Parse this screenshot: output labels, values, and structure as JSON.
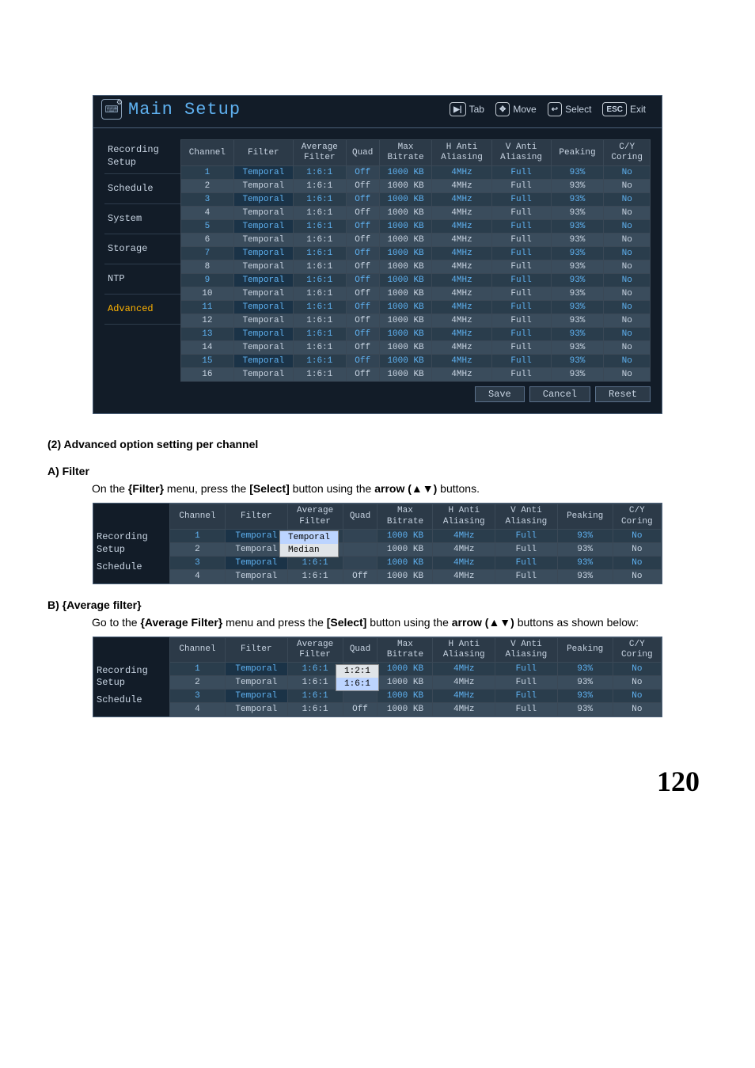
{
  "mainbox": {
    "title": "Main Setup",
    "nav": {
      "tab_icon": "▶|",
      "tab_label": "Tab",
      "move_icon": "✥",
      "move_label": "Move",
      "select_icon": "↩",
      "select_label": "Select",
      "exit_icon": "ESC",
      "exit_label": "Exit"
    },
    "sidebar": [
      {
        "label": "Recording Setup",
        "selected": false
      },
      {
        "label": "Schedule",
        "selected": false
      },
      {
        "label": "System",
        "selected": false
      },
      {
        "label": "Storage",
        "selected": false
      },
      {
        "label": "NTP",
        "selected": false
      },
      {
        "label": "Advanced",
        "selected": true
      }
    ],
    "columns": [
      "Channel",
      "Filter",
      "Average\nFilter",
      "Quad",
      "Max\nBitrate",
      "H Anti\nAliasing",
      "V Anti\nAliasing",
      "Peaking",
      "C/Y\nCoring"
    ],
    "rows": [
      {
        "ch": "1",
        "filter": "Temporal",
        "avg": "1:6:1",
        "quad": "Off",
        "bitrate": "1000 KB",
        "h": "4MHz",
        "v": "Full",
        "peak": "93%",
        "cy": "No",
        "hl": true
      },
      {
        "ch": "2",
        "filter": "Temporal",
        "avg": "1:6:1",
        "quad": "Off",
        "bitrate": "1000 KB",
        "h": "4MHz",
        "v": "Full",
        "peak": "93%",
        "cy": "No",
        "hl": false
      },
      {
        "ch": "3",
        "filter": "Temporal",
        "avg": "1:6:1",
        "quad": "Off",
        "bitrate": "1000 KB",
        "h": "4MHz",
        "v": "Full",
        "peak": "93%",
        "cy": "No",
        "hl": true
      },
      {
        "ch": "4",
        "filter": "Temporal",
        "avg": "1:6:1",
        "quad": "Off",
        "bitrate": "1000 KB",
        "h": "4MHz",
        "v": "Full",
        "peak": "93%",
        "cy": "No",
        "hl": false
      },
      {
        "ch": "5",
        "filter": "Temporal",
        "avg": "1:6:1",
        "quad": "Off",
        "bitrate": "1000 KB",
        "h": "4MHz",
        "v": "Full",
        "peak": "93%",
        "cy": "No",
        "hl": true
      },
      {
        "ch": "6",
        "filter": "Temporal",
        "avg": "1:6:1",
        "quad": "Off",
        "bitrate": "1000 KB",
        "h": "4MHz",
        "v": "Full",
        "peak": "93%",
        "cy": "No",
        "hl": false
      },
      {
        "ch": "7",
        "filter": "Temporal",
        "avg": "1:6:1",
        "quad": "Off",
        "bitrate": "1000 KB",
        "h": "4MHz",
        "v": "Full",
        "peak": "93%",
        "cy": "No",
        "hl": true
      },
      {
        "ch": "8",
        "filter": "Temporal",
        "avg": "1:6:1",
        "quad": "Off",
        "bitrate": "1000 KB",
        "h": "4MHz",
        "v": "Full",
        "peak": "93%",
        "cy": "No",
        "hl": false
      },
      {
        "ch": "9",
        "filter": "Temporal",
        "avg": "1:6:1",
        "quad": "Off",
        "bitrate": "1000 KB",
        "h": "4MHz",
        "v": "Full",
        "peak": "93%",
        "cy": "No",
        "hl": true
      },
      {
        "ch": "10",
        "filter": "Temporal",
        "avg": "1:6:1",
        "quad": "Off",
        "bitrate": "1000 KB",
        "h": "4MHz",
        "v": "Full",
        "peak": "93%",
        "cy": "No",
        "hl": false
      },
      {
        "ch": "11",
        "filter": "Temporal",
        "avg": "1:6:1",
        "quad": "Off",
        "bitrate": "1000 KB",
        "h": "4MHz",
        "v": "Full",
        "peak": "93%",
        "cy": "No",
        "hl": true
      },
      {
        "ch": "12",
        "filter": "Temporal",
        "avg": "1:6:1",
        "quad": "Off",
        "bitrate": "1000 KB",
        "h": "4MHz",
        "v": "Full",
        "peak": "93%",
        "cy": "No",
        "hl": false
      },
      {
        "ch": "13",
        "filter": "Temporal",
        "avg": "1:6:1",
        "quad": "Off",
        "bitrate": "1000 KB",
        "h": "4MHz",
        "v": "Full",
        "peak": "93%",
        "cy": "No",
        "hl": true
      },
      {
        "ch": "14",
        "filter": "Temporal",
        "avg": "1:6:1",
        "quad": "Off",
        "bitrate": "1000 KB",
        "h": "4MHz",
        "v": "Full",
        "peak": "93%",
        "cy": "No",
        "hl": false
      },
      {
        "ch": "15",
        "filter": "Temporal",
        "avg": "1:6:1",
        "quad": "Off",
        "bitrate": "1000 KB",
        "h": "4MHz",
        "v": "Full",
        "peak": "93%",
        "cy": "No",
        "hl": true
      },
      {
        "ch": "16",
        "filter": "Temporal",
        "avg": "1:6:1",
        "quad": "Off",
        "bitrate": "1000 KB",
        "h": "4MHz",
        "v": "Full",
        "peak": "93%",
        "cy": "No",
        "hl": false
      }
    ],
    "buttons": {
      "save": "Save",
      "cancel": "Cancel",
      "reset": "Reset"
    }
  },
  "section2": {
    "heading": "(2) Advanced option setting per channel",
    "a_heading": "A) Filter",
    "a_text_pre": "On the ",
    "a_text_filter": "{Filter}",
    "a_text_mid": " menu, press the ",
    "a_text_select": "[Select]",
    "a_text_mid2": " button using the ",
    "a_text_arrow": "arrow (▲▼)",
    "a_text_end": " buttons.",
    "a_sidebar": [
      {
        "label": "Recording Setup"
      },
      {
        "label": "Schedule"
      }
    ],
    "a_rows": [
      {
        "ch": "1",
        "filter": "Temporal",
        "avg": "",
        "quad": "",
        "bitrate": "1000 KB",
        "h": "4MHz",
        "v": "Full",
        "peak": "93%",
        "cy": "No",
        "hl": true
      },
      {
        "ch": "2",
        "filter": "Temporal",
        "avg": "",
        "quad": "",
        "bitrate": "1000 KB",
        "h": "4MHz",
        "v": "Full",
        "peak": "93%",
        "cy": "No",
        "hl": false
      },
      {
        "ch": "3",
        "filter": "Temporal",
        "avg": "1:6:1",
        "quad": "",
        "bitrate": "1000 KB",
        "h": "4MHz",
        "v": "Full",
        "peak": "93%",
        "cy": "No",
        "hl": true
      },
      {
        "ch": "4",
        "filter": "Temporal",
        "avg": "1:6:1",
        "quad": "Off",
        "bitrate": "1000 KB",
        "h": "4MHz",
        "v": "Full",
        "peak": "93%",
        "cy": "No",
        "hl": false
      }
    ],
    "a_dropdown": {
      "options": [
        "Temporal",
        "Median"
      ],
      "selected": "Temporal"
    },
    "b_heading": "B) {Average filter}",
    "b_text_pre": "Go to the ",
    "b_text_f": "{Average Filter}",
    "b_text_mid": " menu and press the ",
    "b_text_select": "[Select]",
    "b_text_mid2": " button using the ",
    "b_text_arrow": "arrow (▲▼)",
    "b_text_end": " buttons as shown below:",
    "b_rows": [
      {
        "ch": "1",
        "filter": "Temporal",
        "avg": "1:6:1",
        "quad": "",
        "bitrate": "1000 KB",
        "h": "4MHz",
        "v": "Full",
        "peak": "93%",
        "cy": "No",
        "hl": true
      },
      {
        "ch": "2",
        "filter": "Temporal",
        "avg": "1:6:1",
        "quad": "",
        "bitrate": "1000 KB",
        "h": "4MHz",
        "v": "Full",
        "peak": "93%",
        "cy": "No",
        "hl": false
      },
      {
        "ch": "3",
        "filter": "Temporal",
        "avg": "1:6:1",
        "quad": "",
        "bitrate": "1000 KB",
        "h": "4MHz",
        "v": "Full",
        "peak": "93%",
        "cy": "No",
        "hl": true
      },
      {
        "ch": "4",
        "filter": "Temporal",
        "avg": "1:6:1",
        "quad": "Off",
        "bitrate": "1000 KB",
        "h": "4MHz",
        "v": "Full",
        "peak": "93%",
        "cy": "No",
        "hl": false
      }
    ],
    "b_dropdown": {
      "options": [
        "1:2:1",
        "1:6:1"
      ],
      "selected": "1:6:1"
    }
  },
  "pagenum": "120"
}
